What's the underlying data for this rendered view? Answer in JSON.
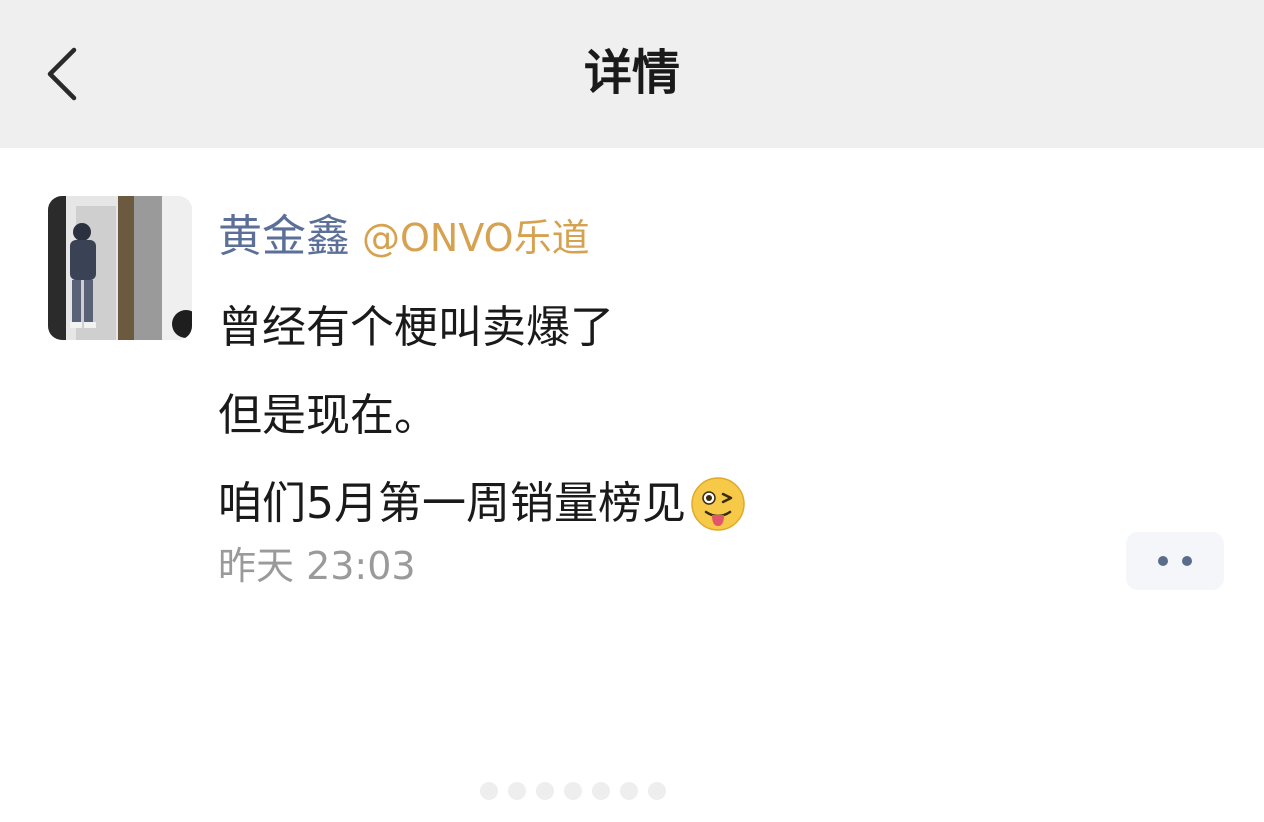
{
  "header": {
    "title": "详情",
    "back_icon": "chevron-left-icon"
  },
  "post": {
    "author_name": "黄金鑫",
    "author_handle": "@ONVO乐道",
    "lines": [
      "曾经有个梗叫卖爆了",
      "但是现在。",
      "咱们5月第一周销量榜见"
    ],
    "emoji": "wink-tongue-emoji",
    "timestamp": "昨天 23:03",
    "more_icon": "more-dots-icon"
  },
  "colors": {
    "header_bg": "#efefef",
    "author_name": "#5b6f99",
    "author_handle": "#d6a24f",
    "timestamp": "#9a9a9a",
    "body_text": "#1a1a1a"
  }
}
